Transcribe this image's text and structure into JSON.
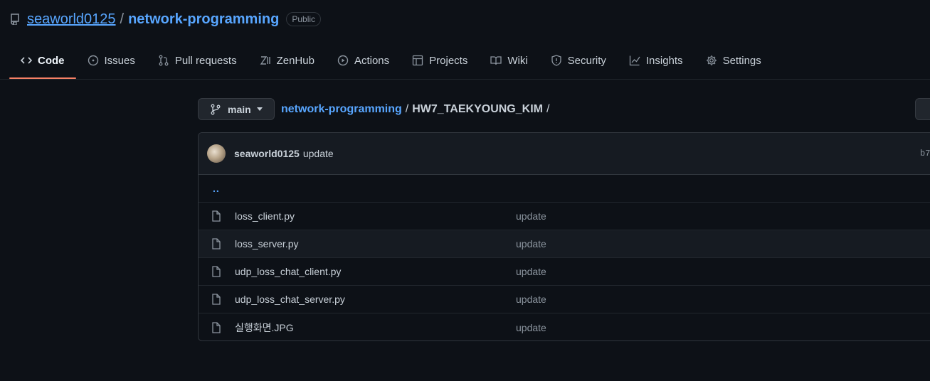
{
  "repo": {
    "owner": "seaworld0125",
    "separator": "/",
    "name": "network-programming",
    "visibility": "Public"
  },
  "tabs": [
    {
      "label": "Code",
      "icon": "code-icon",
      "active": true
    },
    {
      "label": "Issues",
      "icon": "issue-icon"
    },
    {
      "label": "Pull requests",
      "icon": "pull-request-icon"
    },
    {
      "label": "ZenHub",
      "icon": "zenhub-icon"
    },
    {
      "label": "Actions",
      "icon": "play-icon"
    },
    {
      "label": "Projects",
      "icon": "table-icon"
    },
    {
      "label": "Wiki",
      "icon": "book-icon"
    },
    {
      "label": "Security",
      "icon": "shield-icon"
    },
    {
      "label": "Insights",
      "icon": "graph-icon"
    },
    {
      "label": "Settings",
      "icon": "gear-icon"
    }
  ],
  "branch": {
    "name": "main"
  },
  "breadcrumb": {
    "root": "network-programming",
    "sep1": "/",
    "dir": "HW7_TAEKYOUNG_KIM",
    "sep2": "/"
  },
  "commit": {
    "author": "seaworld0125",
    "message": "update",
    "hash_fragment": "b7"
  },
  "parent_dir": "..",
  "files": [
    {
      "name": "loss_client.py",
      "message": "update"
    },
    {
      "name": "loss_server.py",
      "message": "update"
    },
    {
      "name": "udp_loss_chat_client.py",
      "message": "update"
    },
    {
      "name": "udp_loss_chat_server.py",
      "message": "update"
    },
    {
      "name": "실행화면.JPG",
      "message": "update"
    }
  ],
  "colors": {
    "background": "#0d1117",
    "link": "#58a6ff",
    "active_tab_underline": "#f78166",
    "muted_text": "#8b949e"
  }
}
